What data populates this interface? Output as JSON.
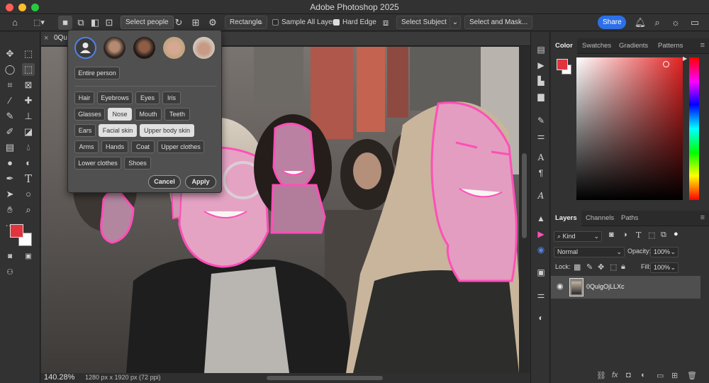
{
  "app": {
    "title": "Adobe Photoshop 2025"
  },
  "options_bar": {
    "select_people_label": "Select people",
    "shape_value": "Rectangle",
    "sample_all_layers_label": "Sample All Layers",
    "sample_all_layers_checked": false,
    "hard_edge_label": "Hard Edge",
    "hard_edge_checked": true,
    "select_subject_label": "Select Subject",
    "select_and_mask_label": "Select and Mask...",
    "share_label": "Share"
  },
  "document": {
    "tab_title": "0Qu",
    "zoom": "140.28%",
    "info": "1280 px x 1920 px (72 ppi)"
  },
  "select_people_popup": {
    "entire_person_label": "Entire person",
    "parts": [
      {
        "label": "Hair",
        "selected": false
      },
      {
        "label": "Eyebrows",
        "selected": false
      },
      {
        "label": "Eyes",
        "selected": false
      },
      {
        "label": "Iris",
        "selected": false
      },
      {
        "label": "Glasses",
        "selected": false
      },
      {
        "label": "Nose",
        "selected": true
      },
      {
        "label": "Mouth",
        "selected": false
      },
      {
        "label": "Teeth",
        "selected": false
      },
      {
        "label": "Ears",
        "selected": false
      },
      {
        "label": "Facial skin",
        "selected": true
      },
      {
        "label": "Upper body skin",
        "selected": true
      },
      {
        "label": "Arms",
        "selected": false
      },
      {
        "label": "Hands",
        "selected": false
      },
      {
        "label": "Coat",
        "selected": false
      },
      {
        "label": "Upper clothes",
        "selected": false
      },
      {
        "label": "Lower clothes",
        "selected": false
      },
      {
        "label": "Shoes",
        "selected": false
      }
    ],
    "cancel_label": "Cancel",
    "apply_label": "Apply"
  },
  "color_panel": {
    "tabs": [
      "Color",
      "Swatches",
      "Gradients",
      "Patterns"
    ],
    "active_tab": "Color",
    "foreground_color": "#e0353f"
  },
  "layers_panel": {
    "tabs": [
      "Layers",
      "Channels",
      "Paths"
    ],
    "active_tab": "Layers",
    "filter_kind": "Kind",
    "blend_mode": "Normal",
    "opacity_label": "Opacity:",
    "opacity_value": "100%",
    "lock_label": "Lock:",
    "fill_label": "Fill:",
    "fill_value": "100%",
    "layers": [
      {
        "name": "0QulgOjLLXc",
        "visible": true
      }
    ]
  },
  "colors": {
    "accent": "#2d6fe6",
    "selection_overlay": "#ff4fb8",
    "foreground": "#e0353f",
    "background": "#ffffff"
  }
}
